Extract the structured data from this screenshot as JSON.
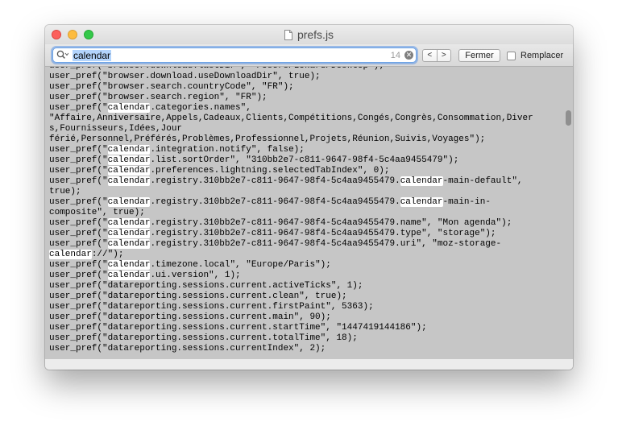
{
  "window": {
    "title": "prefs.js"
  },
  "find_bar": {
    "query": "calendar",
    "match_count": "14",
    "prev_symbol": "<",
    "next_symbol": ">",
    "close_label": "Fermer",
    "replace_label": "Remplacer",
    "replace_checked": false
  },
  "icons": {
    "search": "magnifier-dropdown-icon",
    "clear": "clear-circle-icon",
    "document": "document-icon"
  },
  "colors": {
    "editor_background": "#c6c6c6",
    "match_highlight": "#ffffff",
    "search_focus": "#6ea4e6",
    "close_button": "#fc605c",
    "minimize_button": "#fdbc40",
    "zoom_button": "#34c84a"
  },
  "editor": {
    "lines": [
      "user_pref(\"browser.download.lastDir\", \"/Users/Lekard/Desktop\");",
      "user_pref(\"browser.download.useDownloadDir\", true);",
      "user_pref(\"browser.search.countryCode\", \"FR\");",
      "user_pref(\"browser.search.region\", \"FR\");",
      "user_pref(\"calendar.categories.names\",",
      "\"Affaire,Anniversaire,Appels,Cadeaux,Clients,Compétitions,Congés,Congrès,Consommation,Diver",
      "s,Fournisseurs,Idées,Jour",
      "férié,Personnel,Préférés,Problèmes,Professionnel,Projets,Réunion,Suivis,Voyages\");",
      "user_pref(\"calendar.integration.notify\", false);",
      "user_pref(\"calendar.list.sortOrder\", \"310bb2e7-c811-9647-98f4-5c4aa9455479\");",
      "user_pref(\"calendar.preferences.lightning.selectedTabIndex\", 0);",
      "user_pref(\"calendar.registry.310bb2e7-c811-9647-98f4-5c4aa9455479.calendar-main-default\",",
      "true);",
      "user_pref(\"calendar.registry.310bb2e7-c811-9647-98f4-5c4aa9455479.calendar-main-in-",
      "composite\", true);",
      "user_pref(\"calendar.registry.310bb2e7-c811-9647-98f4-5c4aa9455479.name\", \"Mon agenda\");",
      "user_pref(\"calendar.registry.310bb2e7-c811-9647-98f4-5c4aa9455479.type\", \"storage\");",
      "user_pref(\"calendar.registry.310bb2e7-c811-9647-98f4-5c4aa9455479.uri\", \"moz-storage-",
      "calendar://\");",
      "user_pref(\"calendar.timezone.local\", \"Europe/Paris\");",
      "user_pref(\"calendar.ui.version\", 1);",
      "user_pref(\"datareporting.sessions.current.activeTicks\", 1);",
      "user_pref(\"datareporting.sessions.current.clean\", true);",
      "user_pref(\"datareporting.sessions.current.firstPaint\", 5363);",
      "user_pref(\"datareporting.sessions.current.main\", 90);",
      "user_pref(\"datareporting.sessions.current.startTime\", \"1447419144186\");",
      "user_pref(\"datareporting.sessions.current.totalTime\", 18);",
      "user_pref(\"datareporting.sessions.currentIndex\", 2);"
    ]
  }
}
